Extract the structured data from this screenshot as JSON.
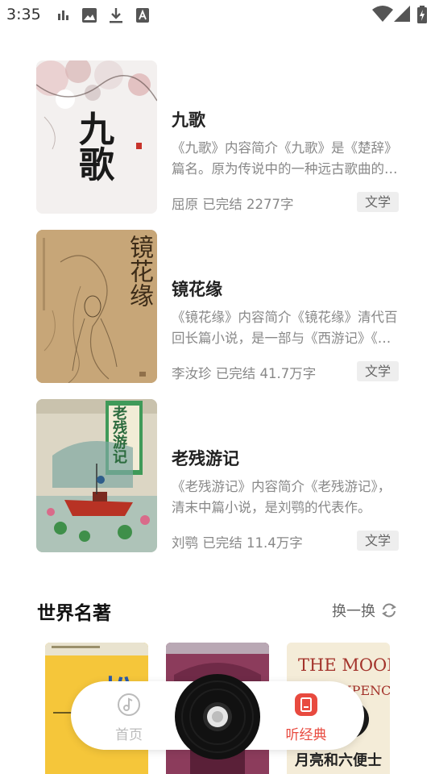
{
  "status_bar": {
    "time": "3:35",
    "left_icons": [
      "data-bars-icon",
      "image-icon",
      "download-icon",
      "font-a-icon"
    ],
    "right_icons": [
      "wifi-icon",
      "cell-signal-icon",
      "battery-charging-icon"
    ]
  },
  "books": [
    {
      "title": "九歌",
      "description": "《九歌》内容简介《九歌》是《楚辞》篇名。原为传说中的一种远古歌曲的名称。",
      "author": "屈原",
      "status": "已完结",
      "word_count": "2277字",
      "tag": "文学",
      "cover_text": "九歌"
    },
    {
      "title": "镜花缘",
      "description": "《镜花缘》内容简介《镜花缘》清代百回长篇小说，是一部与《西游记》《封神榜》同类的神魔小说。",
      "author": "李汝珍",
      "status": "已完结",
      "word_count": "41.7万字",
      "tag": "文学",
      "cover_text": "镜花缘"
    },
    {
      "title": "老残游记",
      "description": "《老残游记》内容简介《老残游记》，清末中篇小说，是刘鹗的代表作。",
      "author": "刘鹗",
      "status": "已完结",
      "word_count": "11.4万字",
      "tag": "文学",
      "cover_text": "老残游记"
    }
  ],
  "section": {
    "title": "世界名著",
    "refresh_label": "换一换"
  },
  "mini_covers": [
    {
      "cover_text": "松"
    },
    {
      "cover_text": ""
    },
    {
      "cover_text": "THE MOON",
      "cover_text2": "SIXPENCE",
      "cover_text3": "月亮和六便士"
    }
  ],
  "bottom_nav": {
    "items": [
      {
        "label": "首页",
        "active": false,
        "icon": "music-note-icon"
      },
      {
        "label": "听经典",
        "active": true,
        "icon": "book-icon"
      }
    ],
    "accent_color": "#e84a3f",
    "inactive_color": "#bbbbbb"
  }
}
